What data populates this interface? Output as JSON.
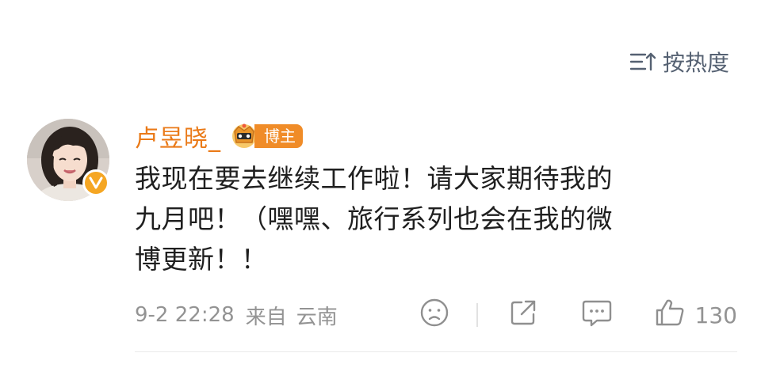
{
  "sort": {
    "label": "按热度",
    "icon": "sort-lines-arrow-icon"
  },
  "comment": {
    "username": "卢昱晓_",
    "host_badge": "博主",
    "text": "我现在要去继续工作啦！请大家期待我的\n九月吧！（嘿嘿、旅行系列也会在我的微\n博更新！！",
    "time": "9-2 22:28",
    "source": "来自",
    "location": "云南",
    "likes": "130",
    "icons": [
      "avatar",
      "verified-v-icon",
      "crown-icon",
      "sad-face-icon",
      "share-icon",
      "comment-icon",
      "thumbs-up-icon"
    ]
  },
  "colors": {
    "username": "#ea7a18",
    "badge": "#f08c28",
    "verified": "#f5a623",
    "meta": "#939393",
    "sort": "#556172"
  }
}
